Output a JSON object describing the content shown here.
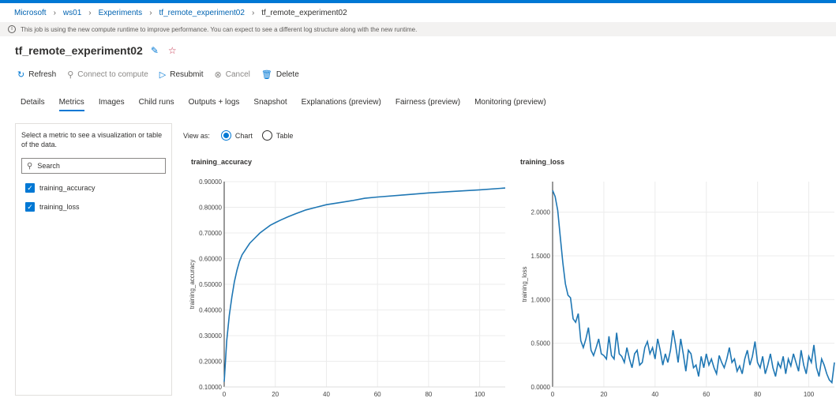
{
  "breadcrumb": [
    "Microsoft",
    "ws01",
    "Experiments",
    "tf_remote_experiment02",
    "tf_remote_experiment02"
  ],
  "banner": {
    "text": "This job is using the new compute runtime to improve performance. You can expect to see a different log structure along with the new runtime."
  },
  "header": {
    "title": "tf_remote_experiment02"
  },
  "toolbar": {
    "refresh": "Refresh",
    "connect": "Connect to compute",
    "resubmit": "Resubmit",
    "cancel": "Cancel",
    "delete": "Delete"
  },
  "tabs": [
    "Details",
    "Metrics",
    "Images",
    "Child runs",
    "Outputs + logs",
    "Snapshot",
    "Explanations (preview)",
    "Fairness (preview)",
    "Monitoring (preview)"
  ],
  "metrics_panel": {
    "hint": "Select a metric to see a visualization or table of the data.",
    "search_placeholder": "Search",
    "items": [
      "training_accuracy",
      "training_loss"
    ]
  },
  "view_as": {
    "label": "View as:",
    "chart": "Chart",
    "table": "Table",
    "selected": "Chart"
  },
  "colors": {
    "accent": "#0078d4",
    "line": "#1f77b4"
  },
  "chart_data": [
    {
      "type": "line",
      "title": "training_accuracy",
      "ylabel": "training_accuracy",
      "xlabel": "",
      "xlim": [
        0,
        110
      ],
      "ylim": [
        0.1,
        0.9
      ],
      "xticks": [
        "0",
        "20",
        "40",
        "60",
        "80",
        "100"
      ],
      "yticks": [
        "0.10000",
        "0.20000",
        "0.30000",
        "0.40000",
        "0.50000",
        "0.60000",
        "0.70000",
        "0.80000",
        "0.90000"
      ],
      "series": [
        {
          "x": [
            0,
            1,
            2,
            3,
            4,
            5,
            6,
            7,
            8,
            9,
            10,
            12,
            14,
            16,
            18,
            20,
            22,
            25,
            28,
            32,
            36,
            40,
            45,
            50,
            55,
            60,
            70,
            80,
            90,
            100,
            110
          ],
          "y": [
            0.12,
            0.28,
            0.38,
            0.45,
            0.51,
            0.555,
            0.59,
            0.615,
            0.63,
            0.645,
            0.66,
            0.68,
            0.7,
            0.715,
            0.73,
            0.74,
            0.75,
            0.763,
            0.775,
            0.79,
            0.8,
            0.81,
            0.818,
            0.826,
            0.835,
            0.84,
            0.848,
            0.856,
            0.862,
            0.868,
            0.875
          ]
        }
      ]
    },
    {
      "type": "line",
      "title": "training_loss",
      "ylabel": "training_loss",
      "xlabel": "",
      "xlim": [
        0,
        110
      ],
      "ylim": [
        0,
        2.35
      ],
      "xticks": [
        "0",
        "20",
        "40",
        "60",
        "80",
        "100"
      ],
      "yticks": [
        "0.0000",
        "0.5000",
        "1.0000",
        "1.5000",
        "2.0000"
      ],
      "series": [
        {
          "x": [
            0,
            1,
            2,
            3,
            4,
            5,
            6,
            7,
            8,
            9,
            10,
            11,
            12,
            13,
            14,
            15,
            16,
            17,
            18,
            19,
            20,
            21,
            22,
            23,
            24,
            25,
            26,
            27,
            28,
            29,
            30,
            31,
            32,
            33,
            34,
            35,
            36,
            37,
            38,
            39,
            40,
            41,
            42,
            43,
            44,
            45,
            46,
            47,
            48,
            49,
            50,
            51,
            52,
            53,
            54,
            55,
            56,
            57,
            58,
            59,
            60,
            61,
            62,
            63,
            64,
            65,
            66,
            67,
            68,
            69,
            70,
            71,
            72,
            73,
            74,
            75,
            76,
            77,
            78,
            79,
            80,
            81,
            82,
            83,
            84,
            85,
            86,
            87,
            88,
            89,
            90,
            91,
            92,
            93,
            94,
            95,
            96,
            97,
            98,
            99,
            100,
            101,
            102,
            103,
            104,
            105,
            106,
            107,
            108,
            109,
            110
          ],
          "y": [
            2.25,
            2.18,
            2.02,
            1.72,
            1.42,
            1.18,
            1.05,
            1.02,
            0.78,
            0.74,
            0.84,
            0.53,
            0.45,
            0.55,
            0.68,
            0.42,
            0.36,
            0.45,
            0.55,
            0.38,
            0.36,
            0.32,
            0.58,
            0.36,
            0.32,
            0.62,
            0.38,
            0.35,
            0.28,
            0.45,
            0.32,
            0.22,
            0.38,
            0.42,
            0.25,
            0.28,
            0.45,
            0.52,
            0.38,
            0.45,
            0.32,
            0.55,
            0.42,
            0.25,
            0.38,
            0.28,
            0.42,
            0.65,
            0.48,
            0.28,
            0.55,
            0.38,
            0.18,
            0.42,
            0.38,
            0.22,
            0.25,
            0.12,
            0.35,
            0.22,
            0.38,
            0.25,
            0.32,
            0.22,
            0.15,
            0.36,
            0.28,
            0.22,
            0.32,
            0.45,
            0.28,
            0.32,
            0.18,
            0.24,
            0.15,
            0.32,
            0.42,
            0.25,
            0.35,
            0.52,
            0.28,
            0.22,
            0.35,
            0.15,
            0.25,
            0.38,
            0.22,
            0.12,
            0.28,
            0.22,
            0.35,
            0.15,
            0.32,
            0.24,
            0.38,
            0.28,
            0.18,
            0.42,
            0.25,
            0.15,
            0.35,
            0.28,
            0.48,
            0.22,
            0.12,
            0.32,
            0.25,
            0.15,
            0.08,
            0.05,
            0.28
          ]
        }
      ]
    }
  ]
}
